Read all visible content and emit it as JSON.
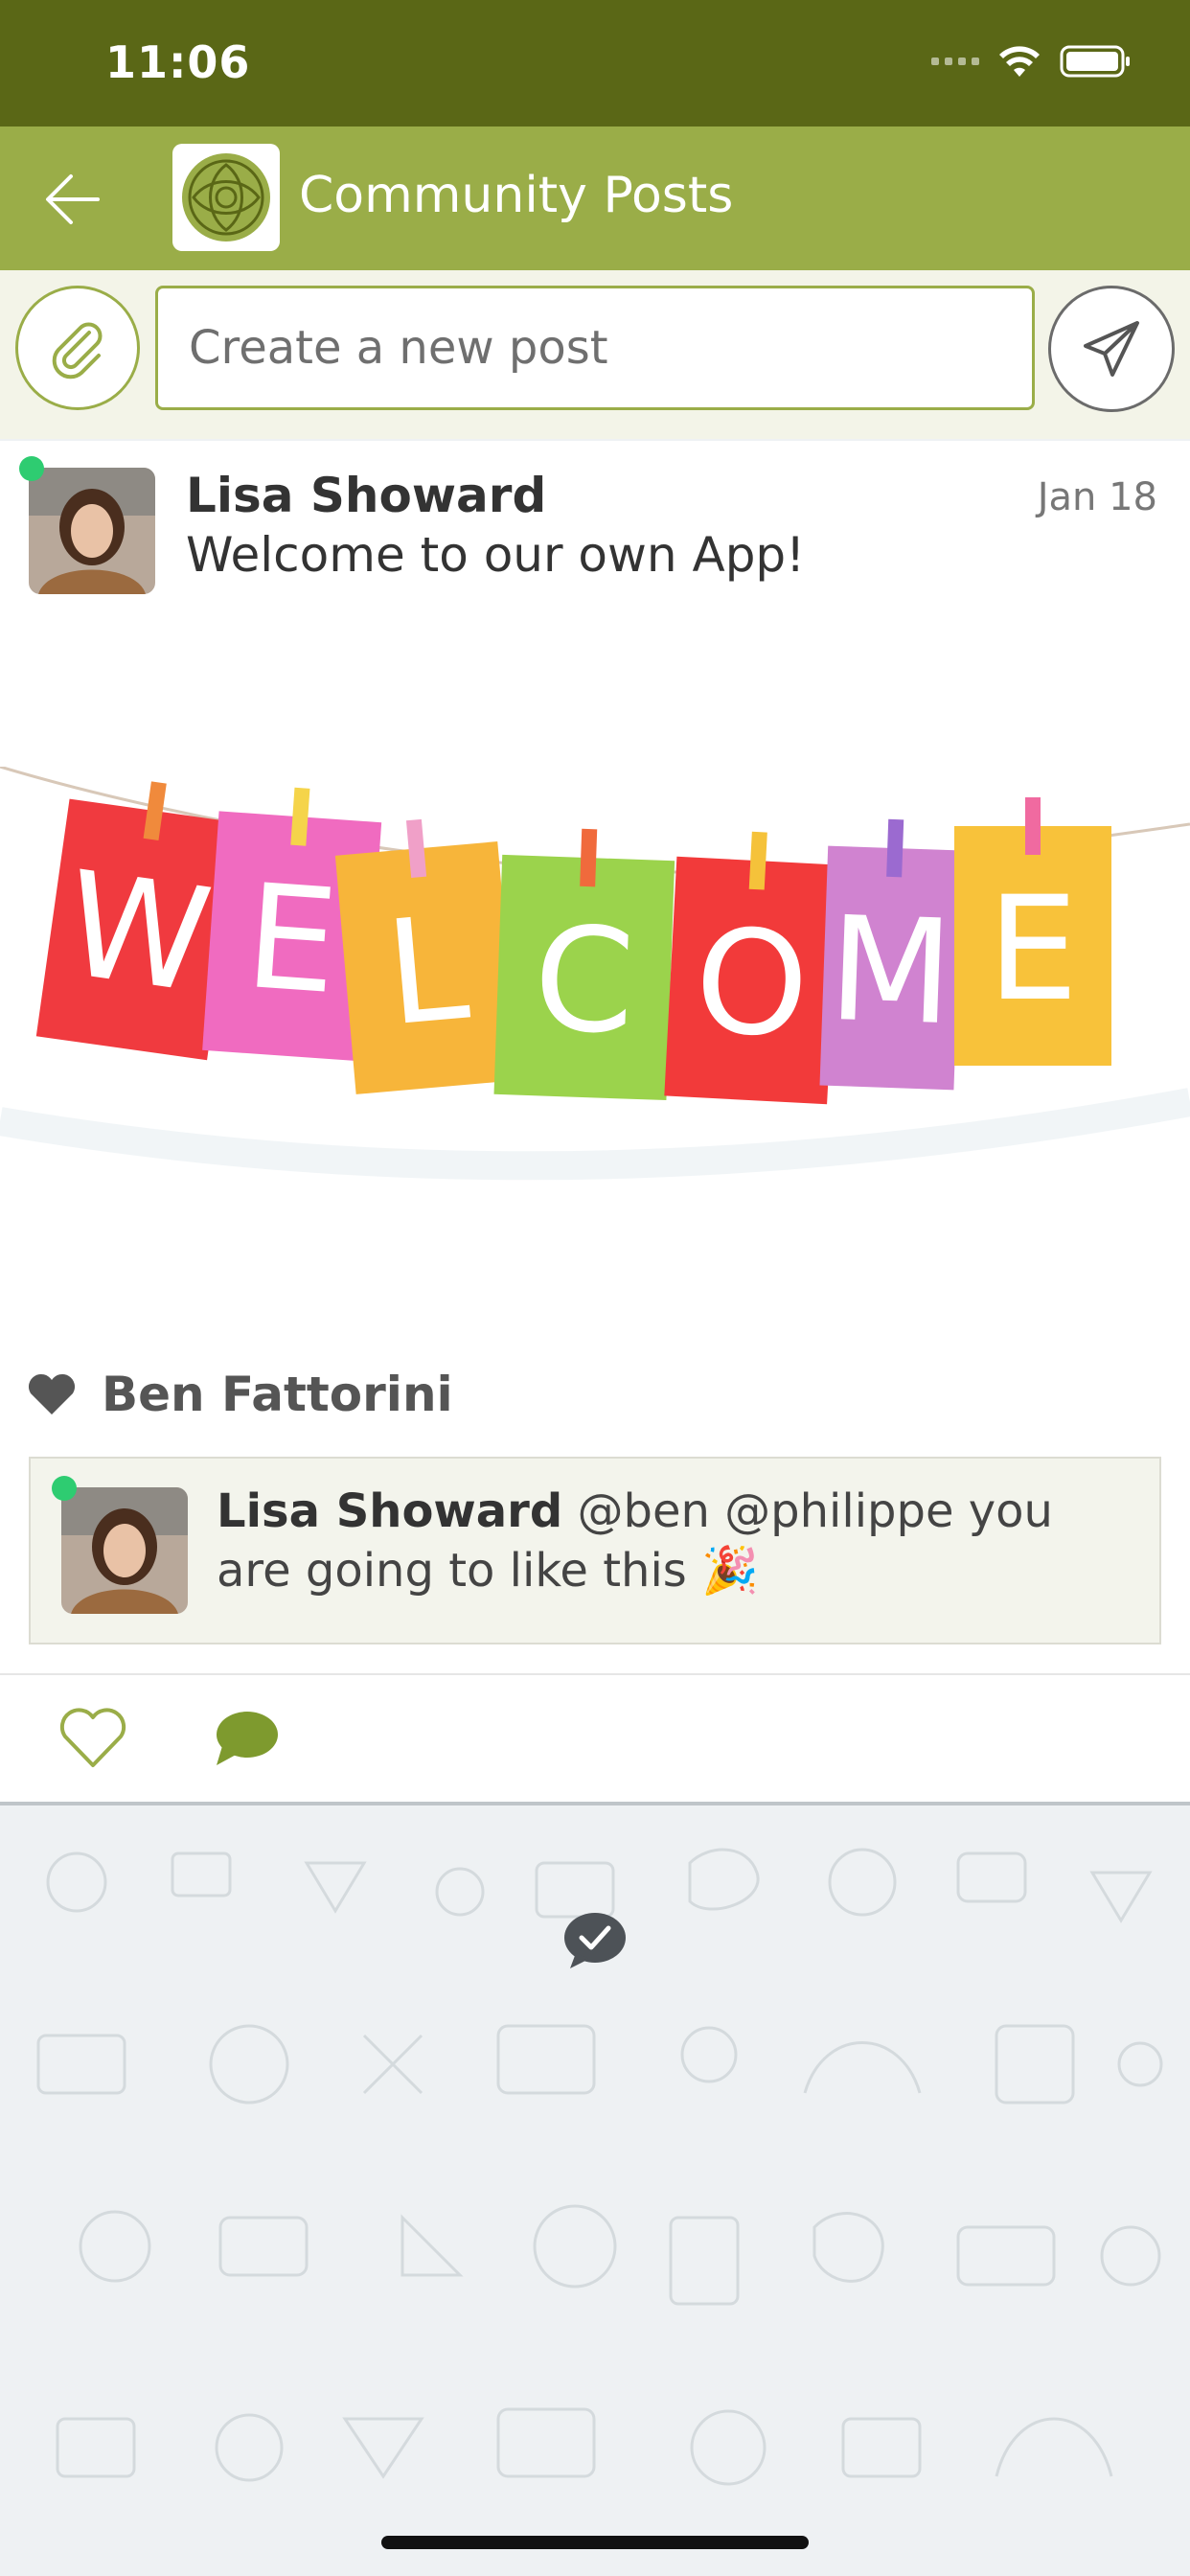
{
  "status_bar": {
    "time": "11:06"
  },
  "nav": {
    "title": "Community Posts"
  },
  "composer": {
    "placeholder": "Create a new post"
  },
  "post": {
    "author": "Lisa Showard",
    "date": "Jan 18",
    "text": "Welcome to our own App!",
    "banner_letters": [
      "W",
      "E",
      "L",
      "C",
      "O",
      "M",
      "E"
    ],
    "liked_by": "Ben Fattorini",
    "comment": {
      "author": "Lisa Showard",
      "text": "@ben @philippe you are going to like this 🎉"
    }
  },
  "colors": {
    "status_bar": "#5a6716",
    "nav_bar": "#9aad48",
    "accent": "#9aad48",
    "online": "#2ecc71"
  }
}
